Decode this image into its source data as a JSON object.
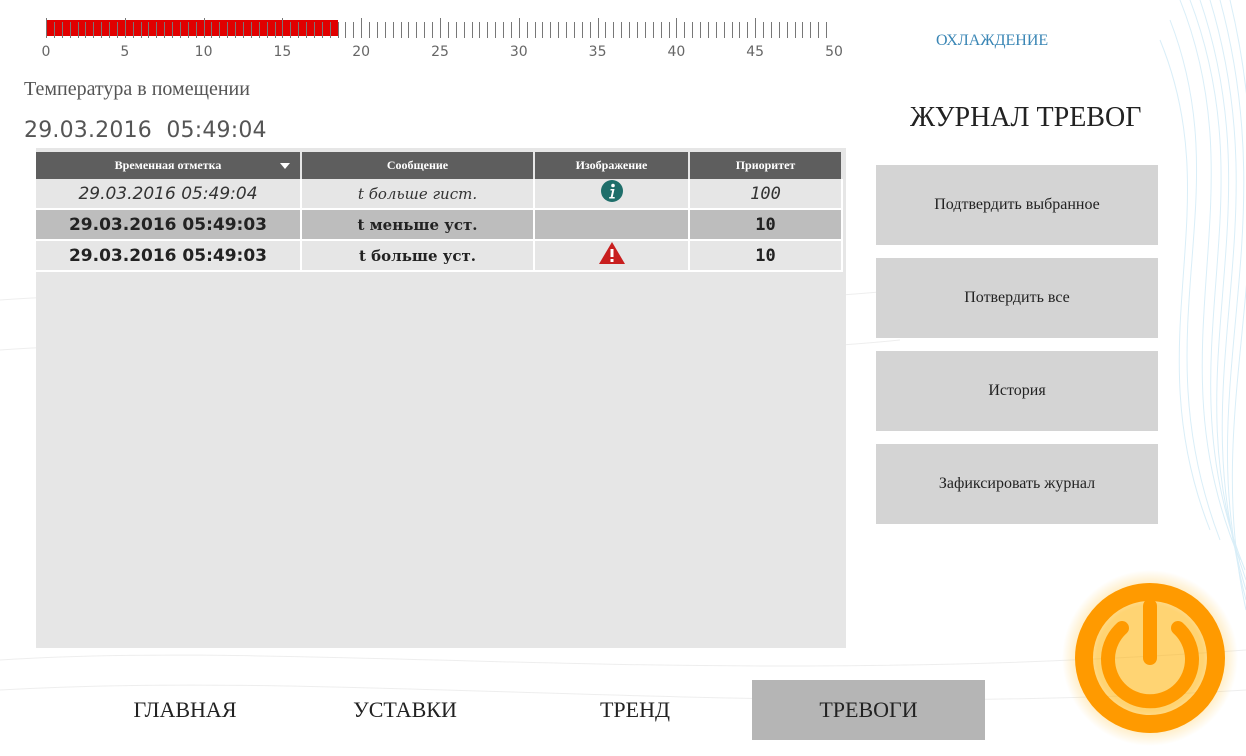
{
  "temperature_scale": {
    "min": 0,
    "max": 50,
    "value": 18.5,
    "tick_labels": [
      "0",
      "5",
      "10",
      "15",
      "20",
      "25",
      "30",
      "35",
      "40",
      "45",
      "50"
    ],
    "fill_color": "#e00000"
  },
  "room_temperature_label": "Температура в помещении",
  "current_datetime": "29.03.2016  05:49:04",
  "mode_link": "ОХЛАЖДЕНИЕ",
  "journal_title": "ЖУРНАЛ ТРЕВОГ",
  "alarm_table": {
    "headers": [
      "Временная отметка",
      "Сообщение",
      "Изображение",
      "Приоритет"
    ],
    "rows": [
      {
        "time": "29.03.2016 05:49:04",
        "message": "t больше гист.",
        "image": "info-icon",
        "priority": "100"
      },
      {
        "time": "29.03.2016 05:49:03",
        "message": "t меньше уст.",
        "image": "",
        "priority": "10"
      },
      {
        "time": "29.03.2016 05:49:03",
        "message": "t больше уст.",
        "image": "warning-icon",
        "priority": "10"
      }
    ]
  },
  "side_buttons": {
    "confirm_selected": "Подтвердить выбранное",
    "confirm_all": "Потвердить все",
    "history": "История",
    "lock_journal": "Зафиксировать журнал"
  },
  "nav": {
    "main": "ГЛАВНАЯ",
    "settings": "УСТАВКИ",
    "trend": "ТРЕНД",
    "alarms": "ТРЕВОГИ",
    "active": "alarms"
  },
  "colors": {
    "accent_link": "#3a86b5",
    "power_button": "#ff9a00",
    "info_icon": "#1e6e6a",
    "warning_icon": "#c81e1e"
  },
  "icons": {
    "power": "power-icon"
  }
}
